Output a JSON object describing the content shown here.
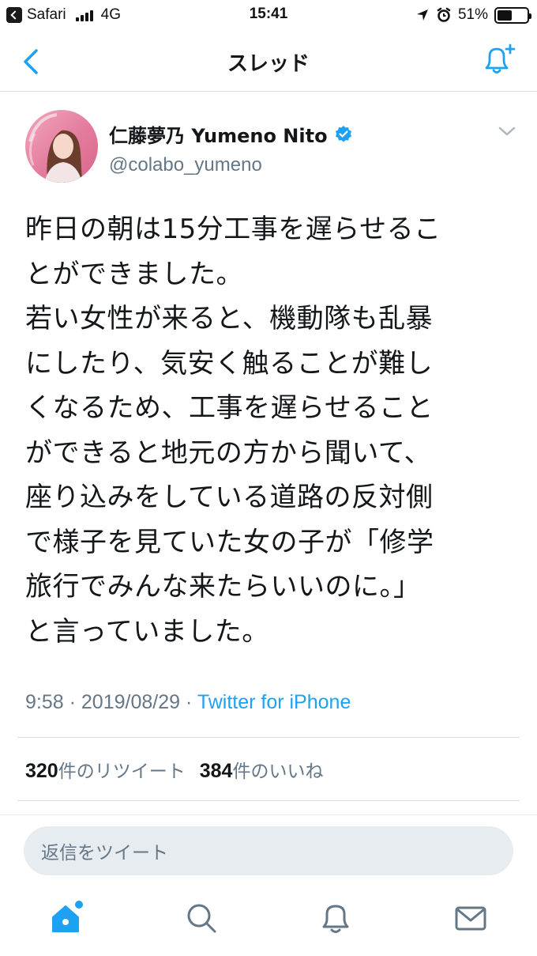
{
  "status_bar": {
    "app": "Safari",
    "network": "4G",
    "time": "15:41",
    "battery_pct": "51%",
    "battery_level": 0.51
  },
  "nav": {
    "title": "スレッド"
  },
  "tweet": {
    "display_name": "仁藤夢乃 Yumeno Nito",
    "handle": "@colabo_yumeno",
    "text": "昨日の朝は15分工事を遅らせるこ\nとができました。\n若い女性が来ると、機動隊も乱暴\nにしたり、気安く触ることが難し\nくなるため、工事を遅らせること\nができると地元の方から聞いて、\n座り込みをしている道路の反対側\nで様子を見ていた女の子が「修学\n旅行でみんな来たらいいのに。」\nと言っていました。",
    "time": "9:58",
    "date": "2019/08/29",
    "separator": "·",
    "source": "Twitter for iPhone",
    "retweet_count": "320",
    "retweet_label": "件のリツイート",
    "like_count": "384",
    "like_label": "件のいいね"
  },
  "reply": {
    "placeholder": "返信をツイート"
  },
  "colors": {
    "accent": "#1da1f2",
    "text": "#14171a",
    "muted": "#657786",
    "border": "#d7dde2"
  },
  "tabs": [
    "home-icon",
    "search-icon",
    "notifications-icon",
    "messages-icon"
  ]
}
